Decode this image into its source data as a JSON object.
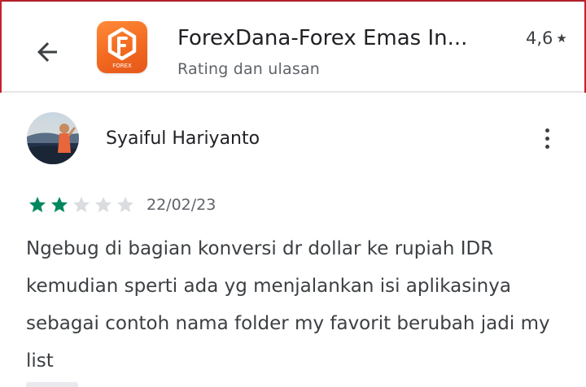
{
  "header": {
    "app_title": "ForexDana-Forex Emas In...",
    "subtitle": "Rating dan ulasan",
    "rating_value": "4,6",
    "rating_star": "★",
    "icon_caption": "FOREX",
    "accent_color": "#f26a1f"
  },
  "review": {
    "reviewer_name": "Syaiful Hariyanto",
    "rating": 2,
    "rating_max": 5,
    "date": "22/02/23",
    "text": "Ngebug di bagian konversi dr dollar ke rupiah IDR kemudian sperti ada yg menjalankan isi aplikasinya sebagai contoh nama folder my favorit berubah jadi my list",
    "star_filled_color": "#01875f",
    "star_empty_color": "#dadce0"
  },
  "icons": {
    "back": "arrow-left-icon",
    "more": "more-vert-icon",
    "star": "star-icon"
  }
}
